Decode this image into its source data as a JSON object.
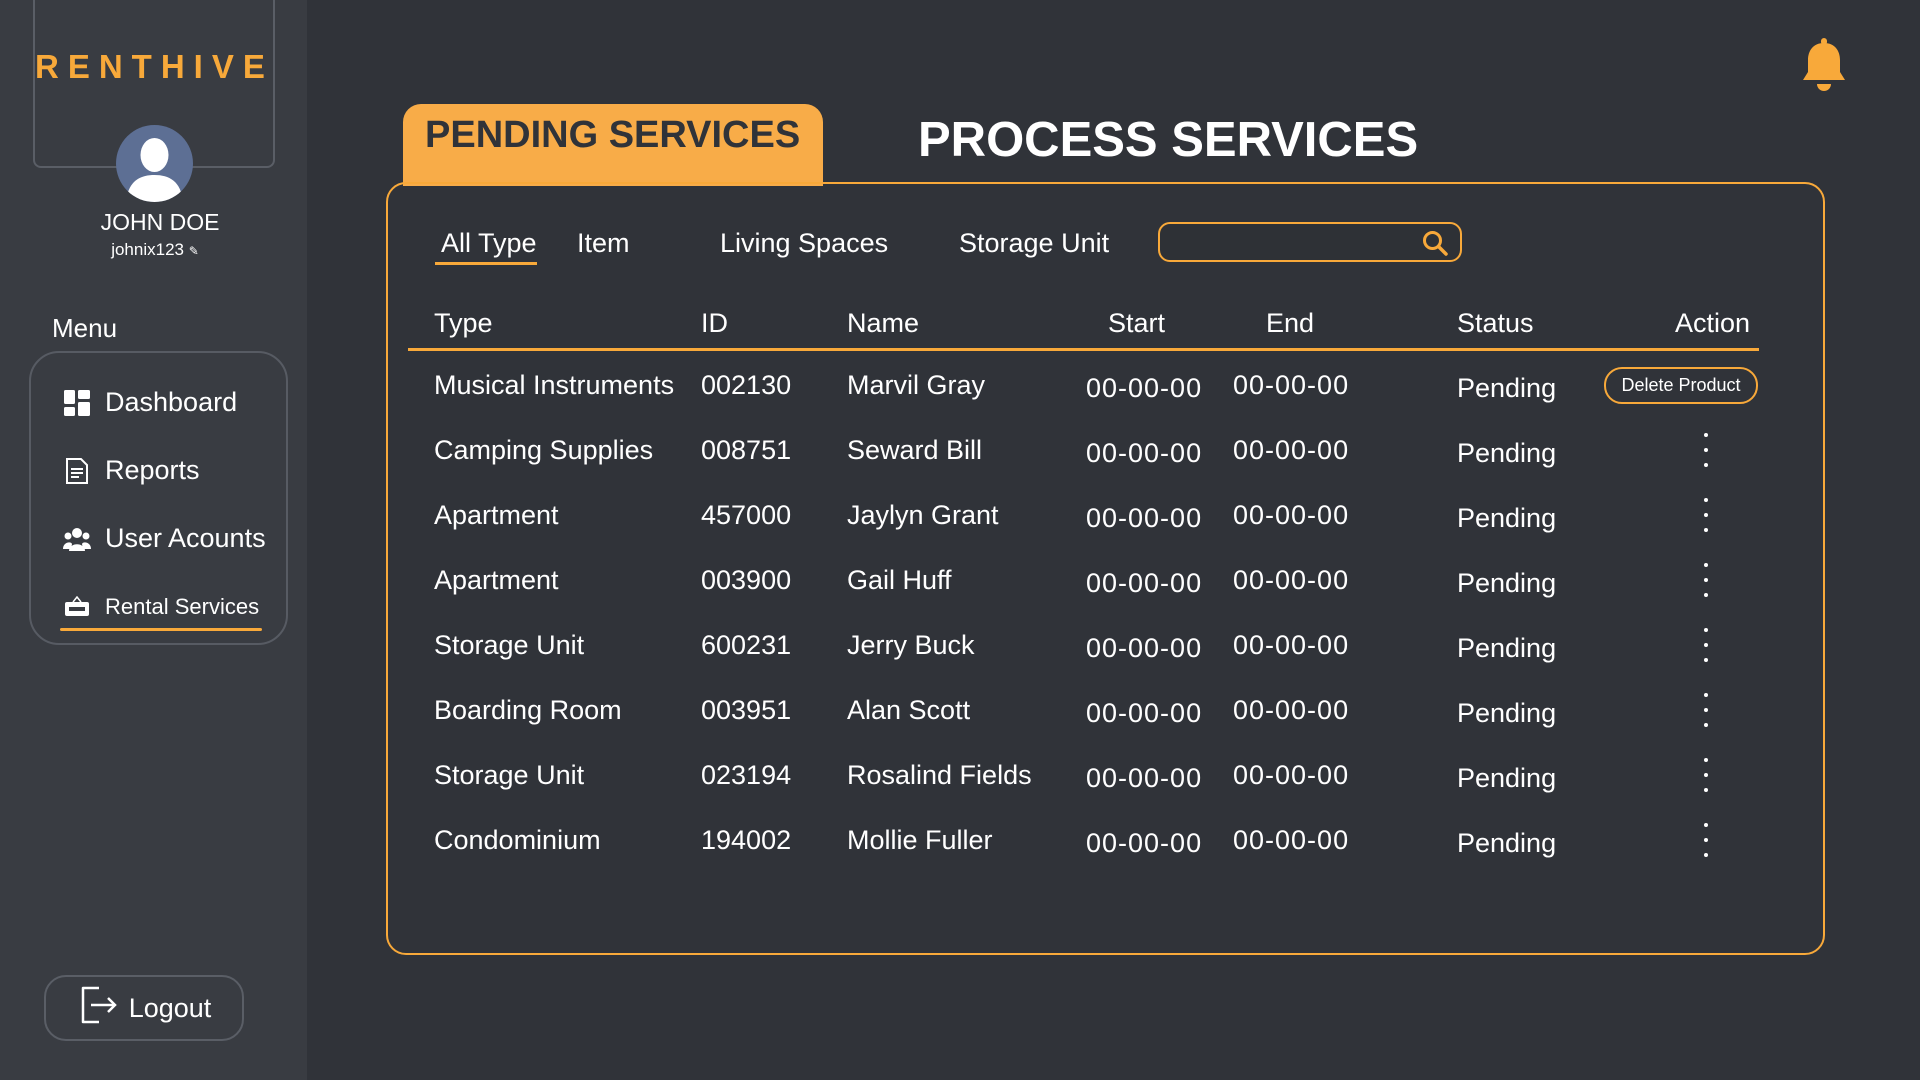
{
  "app": {
    "logo": "RENTHIVE"
  },
  "user": {
    "name": "JOHN DOE",
    "handle": "johnix123"
  },
  "sidebar": {
    "menu_title": "Menu",
    "items": [
      {
        "label": "Dashboard",
        "icon": "dashboard-grid-icon"
      },
      {
        "label": "Reports",
        "icon": "document-icon"
      },
      {
        "label": "User Acounts",
        "icon": "users-group-icon"
      },
      {
        "label": "Rental Services",
        "icon": "rent-sign-icon",
        "active": true
      }
    ],
    "logout_label": "Logout"
  },
  "header": {
    "tab_pending": "PENDING SERVICES",
    "tab_process": "PROCESS SERVICES",
    "notification_icon": "bell-icon"
  },
  "filters": {
    "items": [
      "All Type",
      "Item",
      "Living Spaces",
      "Storage Unit"
    ],
    "active": "All Type"
  },
  "search": {
    "value": "",
    "placeholder": ""
  },
  "table": {
    "columns": [
      "Type",
      "ID",
      "Name",
      "Start",
      "End",
      "Status",
      "Action"
    ],
    "rows": [
      {
        "type": "Musical Instruments",
        "id": "002130",
        "name": "Marvil Gray",
        "start": "00-00-00",
        "end": "00-00-00",
        "status": "Pending",
        "action": "Delete Product"
      },
      {
        "type": "Camping Supplies",
        "id": "008751",
        "name": "Seward Bill",
        "start": "00-00-00",
        "end": "00-00-00",
        "status": "Pending",
        "action": "more"
      },
      {
        "type": "Apartment",
        "id": "457000",
        "name": "Jaylyn Grant",
        "start": "00-00-00",
        "end": "00-00-00",
        "status": "Pending",
        "action": "more"
      },
      {
        "type": "Apartment",
        "id": "003900",
        "name": "Gail Huff",
        "start": "00-00-00",
        "end": "00-00-00",
        "status": "Pending",
        "action": "more"
      },
      {
        "type": "Storage Unit",
        "id": "600231",
        "name": "Jerry Buck",
        "start": "00-00-00",
        "end": "00-00-00",
        "status": "Pending",
        "action": "more"
      },
      {
        "type": "Boarding Room",
        "id": "003951",
        "name": "Alan Scott",
        "start": "00-00-00",
        "end": "00-00-00",
        "status": "Pending",
        "action": "more"
      },
      {
        "type": "Storage Unit",
        "id": "023194",
        "name": "Rosalind Fields",
        "start": "00-00-00",
        "end": "00-00-00",
        "status": "Pending",
        "action": "more"
      },
      {
        "type": "Condominium",
        "id": "194002",
        "name": "Mollie Fuller",
        "start": "00-00-00",
        "end": "00-00-00",
        "status": "Pending",
        "action": "more"
      }
    ]
  },
  "colors": {
    "accent": "#f8a93a",
    "background": "#303339",
    "sidebar": "#393c42"
  }
}
